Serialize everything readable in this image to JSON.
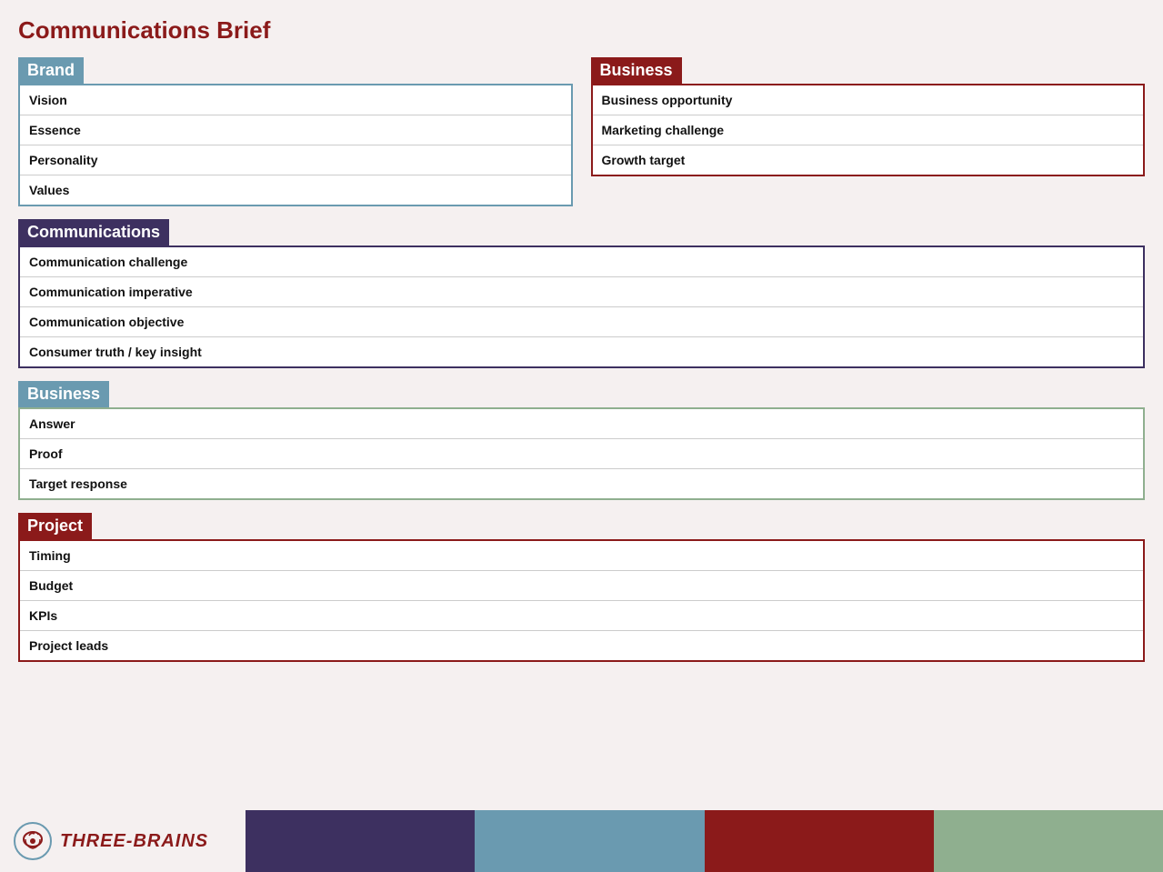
{
  "page": {
    "title": "Communications Brief"
  },
  "brand_section": {
    "header": "Brand",
    "rows": [
      {
        "label": "Vision",
        "value": ""
      },
      {
        "label": "Essence",
        "value": ""
      },
      {
        "label": "Personality",
        "value": ""
      },
      {
        "label": "Values",
        "value": ""
      }
    ]
  },
  "business_section": {
    "header": "Business",
    "rows": [
      {
        "label": "Business opportunity",
        "value": ""
      },
      {
        "label": "Marketing challenge",
        "value": ""
      },
      {
        "label": "Growth target",
        "value": ""
      }
    ]
  },
  "communications_section": {
    "header": "Communications",
    "rows": [
      {
        "label": "Communication challenge",
        "value": ""
      },
      {
        "label": "Communication imperative",
        "value": ""
      },
      {
        "label": "Communication objective",
        "value": ""
      },
      {
        "label": "Consumer truth / key insight",
        "value": ""
      }
    ]
  },
  "business2_section": {
    "header": "Business",
    "rows": [
      {
        "label": "Answer",
        "value": ""
      },
      {
        "label": "Proof",
        "value": ""
      },
      {
        "label": "Target response",
        "value": ""
      }
    ]
  },
  "project_section": {
    "header": "Project",
    "rows": [
      {
        "label": "Timing",
        "value": ""
      },
      {
        "label": "Budget",
        "value": ""
      },
      {
        "label": "KPIs",
        "value": ""
      },
      {
        "label": "Project leads",
        "value": ""
      }
    ]
  },
  "footer": {
    "logo_text": "THREE-BRAINS"
  }
}
